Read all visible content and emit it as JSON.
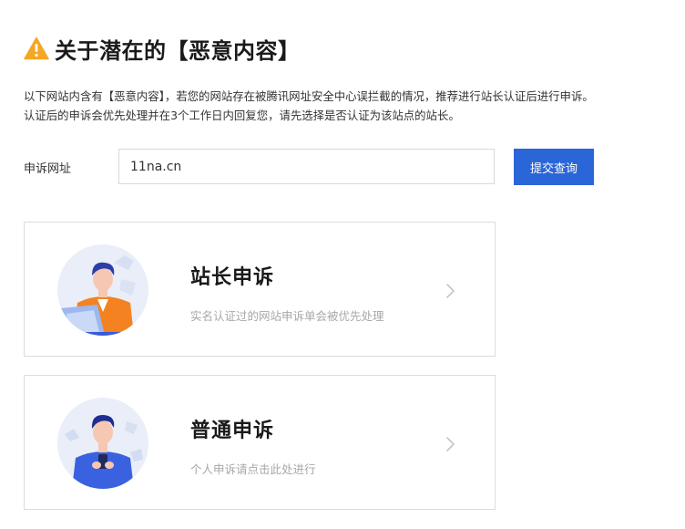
{
  "header": {
    "icon": "warning-triangle-icon",
    "title": "关于潜在的【恶意内容】"
  },
  "description": {
    "line1": "以下网站内含有【恶意内容】，若您的网站存在被腾讯网址安全中心误拦截的情况，推荐进行站长认证后进行申诉。",
    "line2": "认证后的申诉会优先处理并在3个工作日内回复您，请先选择是否认证为该站点的站长。"
  },
  "form": {
    "label": "申诉网址",
    "url_value": "11na.cn",
    "submit_label": "提交查询"
  },
  "cards": [
    {
      "title": "站长申诉",
      "subtitle": "实名认证过的网站申诉单会被优先处理",
      "avatar": "webmaster-illustration",
      "chevron": "chevron-right-icon"
    },
    {
      "title": "普通申诉",
      "subtitle": "个人申诉请点击此处进行",
      "avatar": "personal-user-illustration",
      "chevron": "chevron-right-icon"
    }
  ],
  "colors": {
    "accent": "#2b66d9",
    "warning": "#f5a623",
    "muted_text": "#a8a8a8",
    "border": "#dcdcdc"
  }
}
